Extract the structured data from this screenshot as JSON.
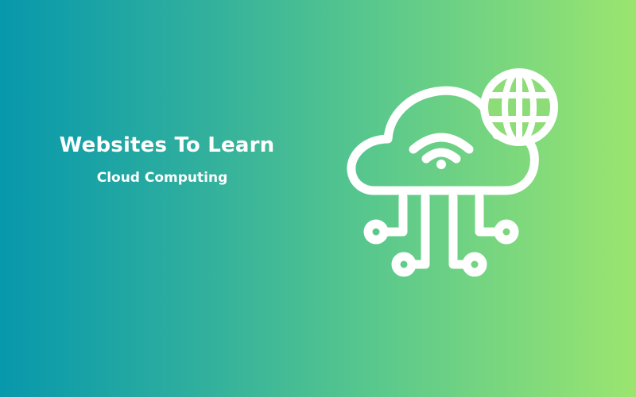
{
  "banner": {
    "title": "Websites To Learn",
    "subtitle": "Cloud Computing"
  },
  "illustration": {
    "icon": "cloud-network-icon",
    "parts": [
      "cloud-outline",
      "wifi-signal",
      "globe",
      "circuit-connectors"
    ],
    "stroke_color": "#ffffff"
  },
  "colors": {
    "gradient_start": "#0798ac",
    "gradient_end": "#9be56f",
    "text": "#ffffff"
  }
}
